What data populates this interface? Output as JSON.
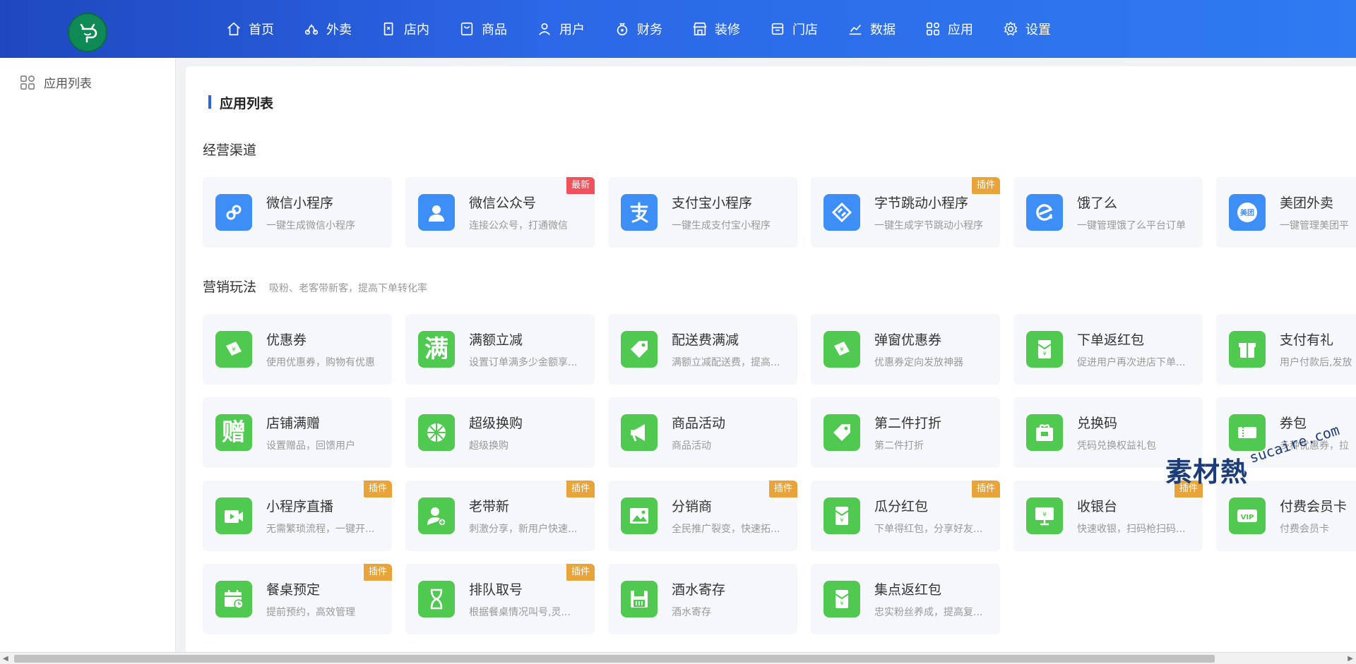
{
  "colors": {
    "brand": "#2b67e6",
    "accent_green": "#4fc94f",
    "accent_blue": "#3d8ef7",
    "badge_new": "#f0525c",
    "badge_plugin": "#e8a43b"
  },
  "nav": [
    {
      "label": "首页",
      "icon": "home-icon"
    },
    {
      "label": "外卖",
      "icon": "scooter-icon"
    },
    {
      "label": "店内",
      "icon": "dine-in-icon"
    },
    {
      "label": "商品",
      "icon": "product-icon"
    },
    {
      "label": "用户",
      "icon": "user-icon"
    },
    {
      "label": "财务",
      "icon": "finance-icon"
    },
    {
      "label": "装修",
      "icon": "decoration-icon"
    },
    {
      "label": "门店",
      "icon": "store-icon"
    },
    {
      "label": "数据",
      "icon": "chart-icon"
    },
    {
      "label": "应用",
      "icon": "apps-icon"
    },
    {
      "label": "设置",
      "icon": "gear-icon"
    }
  ],
  "sidebar": {
    "item_label": "应用列表"
  },
  "page": {
    "title": "应用列表"
  },
  "sections": {
    "channels": {
      "title": "经营渠道",
      "subtitle": ""
    },
    "marketing": {
      "title": "营销玩法",
      "subtitle": "吸粉、老客带新客，提高下单转化率"
    }
  },
  "channel_apps": [
    {
      "name": "微信小程序",
      "desc": "一键生成微信小程序",
      "icon": "wechat-miniprogram-icon",
      "badge": ""
    },
    {
      "name": "微信公众号",
      "desc": "连接公众号，打通微信",
      "icon": "wechat-official-icon",
      "badge": "最新"
    },
    {
      "name": "支付宝小程序",
      "desc": "一键生成支付宝小程序",
      "icon": "alipay-icon",
      "badge": ""
    },
    {
      "name": "字节跳动小程序",
      "desc": "一键生成字节跳动小程序",
      "icon": "bytedance-icon",
      "badge": "插件"
    },
    {
      "name": "饿了么",
      "desc": "一键管理饿了么平台订单",
      "icon": "eleme-icon",
      "badge": ""
    },
    {
      "name": "美团外卖",
      "desc": "一键管理美团平",
      "icon": "meituan-icon",
      "badge": "",
      "icon_text": "美团"
    }
  ],
  "marketing_apps": [
    {
      "name": "优惠券",
      "desc": "使用优惠券，购物有优惠",
      "icon": "coupon-icon",
      "badge": ""
    },
    {
      "name": "满额立减",
      "desc": "设置订单满多少金额享...",
      "icon": "discount-icon",
      "badge": "",
      "icon_text": "满"
    },
    {
      "name": "配送费满减",
      "desc": "满额立减配送费，提高...",
      "icon": "tag-icon",
      "badge": ""
    },
    {
      "name": "弹窗优惠券",
      "desc": "优惠券定向发放神器",
      "icon": "popup-coupon-icon",
      "badge": ""
    },
    {
      "name": "下单返红包",
      "desc": "促进用户再次进店下单...",
      "icon": "red-envelope-icon",
      "badge": ""
    },
    {
      "name": "支付有礼",
      "desc": "用户付款后,发放",
      "icon": "gift-icon",
      "badge": ""
    },
    {
      "name": "店铺满赠",
      "desc": "设置赠品，回馈用户",
      "icon": "gift-text-icon",
      "badge": "",
      "icon_text": "赠"
    },
    {
      "name": "超级换购",
      "desc": "超级换购",
      "icon": "wheel-icon",
      "badge": ""
    },
    {
      "name": "商品活动",
      "desc": "商品活动",
      "icon": "megaphone-icon",
      "badge": ""
    },
    {
      "name": "第二件打折",
      "desc": "第二件打折",
      "icon": "price-tag-icon",
      "badge": ""
    },
    {
      "name": "兑换码",
      "desc": "凭码兑换权益礼包",
      "icon": "redeem-icon",
      "badge": ""
    },
    {
      "name": "券包",
      "desc": "多种优惠券，拉",
      "icon": "coupon-pack-icon",
      "badge": ""
    },
    {
      "name": "小程序直播",
      "desc": "无需繁琐流程，一键开...",
      "icon": "live-video-icon",
      "badge": "插件"
    },
    {
      "name": "老带新",
      "desc": "刺激分享，新用户快速...",
      "icon": "referral-icon",
      "badge": "插件"
    },
    {
      "name": "分销商",
      "desc": "全民推广裂变，快速拓...",
      "icon": "image-icon",
      "badge": "插件"
    },
    {
      "name": "瓜分红包",
      "desc": "下单得红包，分享好友...",
      "icon": "split-envelope-icon",
      "badge": "插件"
    },
    {
      "name": "收银台",
      "desc": "快速收银，扫码枪扫码...",
      "icon": "cashier-icon",
      "badge": "插件"
    },
    {
      "name": "付费会员卡",
      "desc": "付费会员卡",
      "icon": "vip-card-icon",
      "badge": ""
    },
    {
      "name": "餐桌预定",
      "desc": "提前预约，高效管理",
      "icon": "calendar-icon",
      "badge": "插件"
    },
    {
      "name": "排队取号",
      "desc": "根据餐桌情况叫号,灵...",
      "icon": "hourglass-icon",
      "badge": "插件"
    },
    {
      "name": "酒水寄存",
      "desc": "酒水寄存",
      "icon": "floppy-icon",
      "badge": ""
    },
    {
      "name": "集点返红包",
      "desc": "忠实粉丝养成，提高复...",
      "icon": "points-envelope-icon",
      "badge": ""
    }
  ],
  "watermark": {
    "text": "素材熱",
    "sub": "sucaire.com"
  }
}
